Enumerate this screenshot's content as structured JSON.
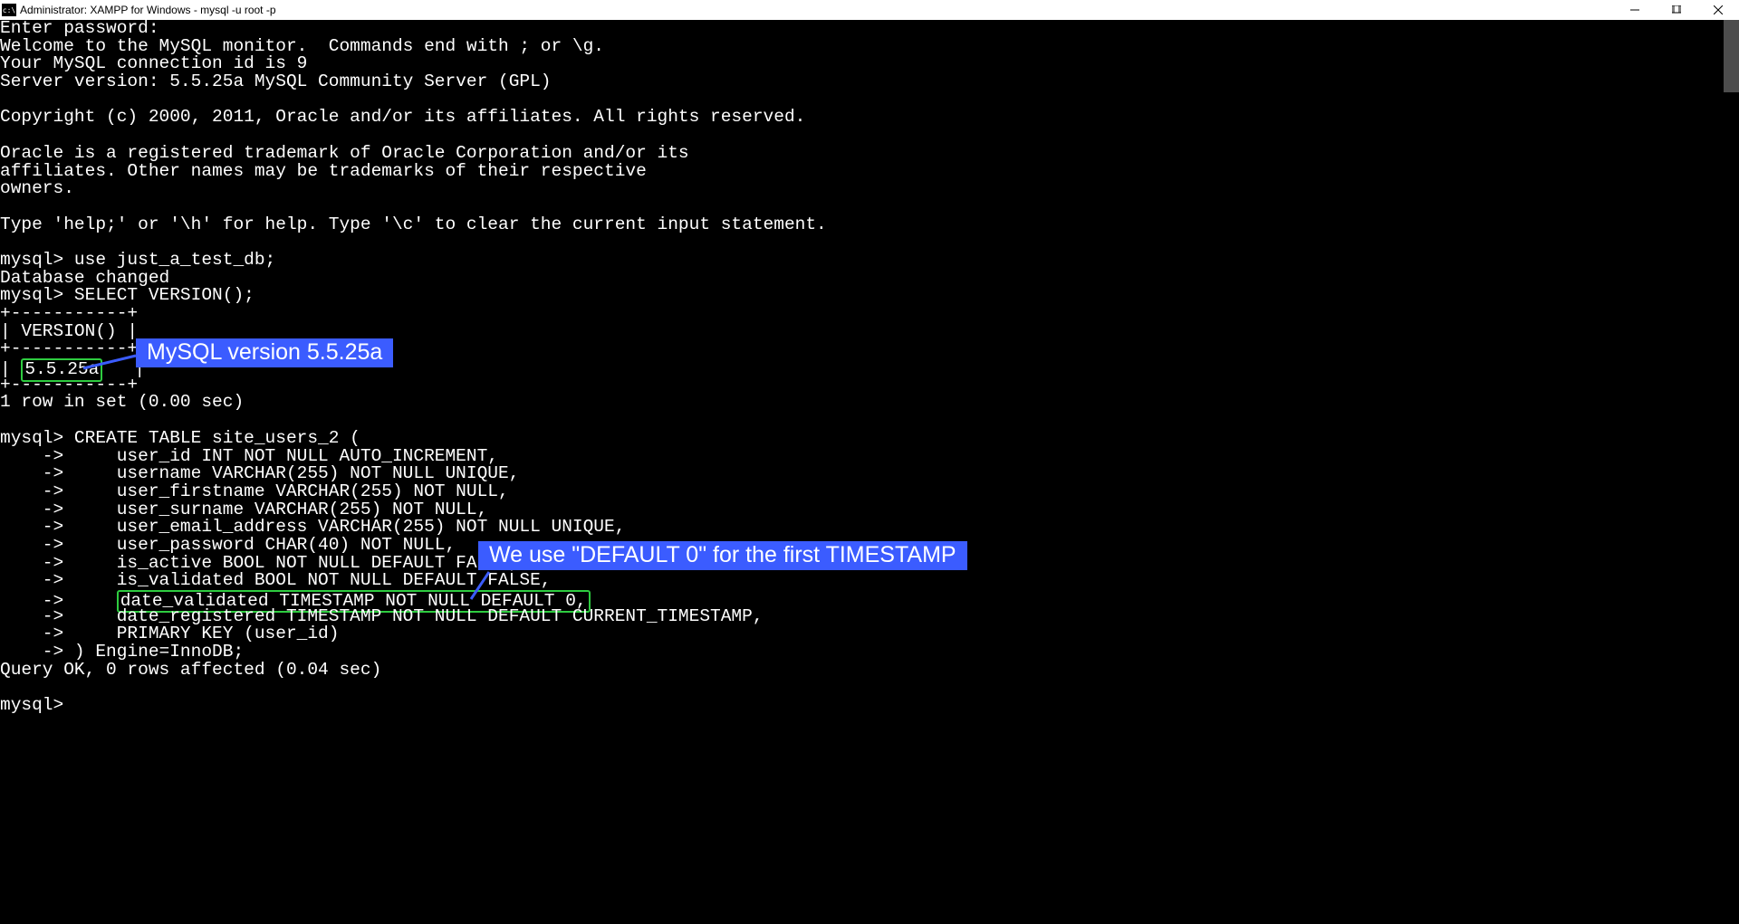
{
  "window": {
    "title": "Administrator: XAMPP for Windows - mysql  -u root -p",
    "icon_label": "cmd"
  },
  "terminal": {
    "lines": [
      "Enter password:",
      "Welcome to the MySQL monitor.  Commands end with ; or \\g.",
      "Your MySQL connection id is 9",
      "Server version: 5.5.25a MySQL Community Server (GPL)",
      "",
      "Copyright (c) 2000, 2011, Oracle and/or its affiliates. All rights reserved.",
      "",
      "Oracle is a registered trademark of Oracle Corporation and/or its",
      "affiliates. Other names may be trademarks of their respective",
      "owners.",
      "",
      "Type 'help;' or '\\h' for help. Type '\\c' to clear the current input statement.",
      "",
      "mysql> use just_a_test_db;",
      "Database changed",
      "mysql> SELECT VERSION();",
      "+-----------+",
      "| VERSION() |",
      "+-----------+"
    ],
    "version_row_prefix": "| ",
    "version_value": "5.5.25a",
    "version_row_suffix": "   |",
    "lines_after_version": [
      "+-----------+",
      "1 row in set (0.00 sec)",
      "",
      "mysql> CREATE TABLE site_users_2 (",
      "    ->     user_id INT NOT NULL AUTO_INCREMENT,",
      "    ->     username VARCHAR(255) NOT NULL UNIQUE,",
      "    ->     user_firstname VARCHAR(255) NOT NULL,",
      "    ->     user_surname VARCHAR(255) NOT NULL,",
      "    ->     user_email_address VARCHAR(255) NOT NULL UNIQUE,",
      "    ->     user_password CHAR(40) NOT NULL,",
      "    ->     is_active BOOL NOT NULL DEFAULT FALSE,",
      "    ->     is_validated BOOL NOT NULL DEFAULT FALSE,"
    ],
    "highlight_line_prefix": "    ->     ",
    "highlight_line_text": "date_validated TIMESTAMP NOT NULL DEFAULT 0,",
    "lines_after_highlight": [
      "    ->     date_registered TIMESTAMP NOT NULL DEFAULT CURRENT_TIMESTAMP,",
      "    ->     PRIMARY KEY (user_id)",
      "    -> ) Engine=InnoDB;",
      "Query OK, 0 rows affected (0.04 sec)",
      "",
      "mysql>"
    ]
  },
  "annotations": {
    "version_label": "MySQL version 5.5.25a",
    "timestamp_label": "We use \"DEFAULT 0\" for the first TIMESTAMP"
  }
}
